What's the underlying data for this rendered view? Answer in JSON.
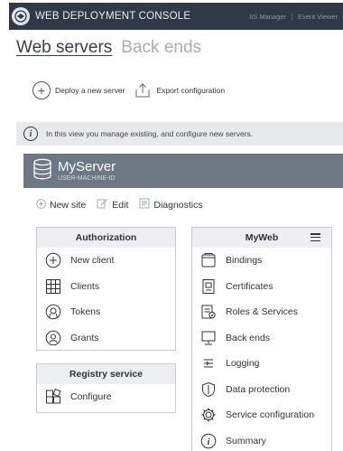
{
  "window": {
    "title": "WEB DEPLOYMENT CONSOLE",
    "links": [
      "IIS Manager",
      "Event Viewer"
    ]
  },
  "tabs": [
    {
      "label": "Web servers",
      "active": true
    },
    {
      "label": "Back ends",
      "active": false
    }
  ],
  "toolbar": {
    "deploy_label": "Deploy a new server",
    "export_label": "Export configuration"
  },
  "info": {
    "text": "In this view you manage existing, and configure new servers."
  },
  "server": {
    "name": "MyServer",
    "machine": "USER-MACHINE-ID"
  },
  "server_actions": {
    "new_site": "New site",
    "edit": "Edit",
    "diagnostics": "Diagnostics"
  },
  "authorization": {
    "title": "Authorization",
    "items": [
      {
        "label": "New client",
        "icon": "plus-circle-icon"
      },
      {
        "label": "Clients",
        "icon": "grid-icon"
      },
      {
        "label": "Tokens",
        "icon": "token-icon"
      },
      {
        "label": "Grants",
        "icon": "grant-icon"
      }
    ]
  },
  "registry": {
    "title": "Registry service",
    "items": [
      {
        "label": "Configure",
        "icon": "configure-icon"
      }
    ]
  },
  "myweb": {
    "title": "MyWeb",
    "items": [
      {
        "label": "Bindings",
        "icon": "bindings-icon"
      },
      {
        "label": "Certificates",
        "icon": "certificate-icon"
      },
      {
        "label": "Roles & Services",
        "icon": "roles-icon"
      },
      {
        "label": "Back ends",
        "icon": "backends-icon"
      },
      {
        "label": "Logging",
        "icon": "logging-icon"
      },
      {
        "label": "Data protection",
        "icon": "shield-icon"
      },
      {
        "label": "Service configuration",
        "icon": "gear-icon"
      },
      {
        "label": "Summary",
        "icon": "info-icon"
      }
    ]
  },
  "colors": {
    "titlebar": "#2f3a46",
    "server_header": "#6d7884",
    "infobar": "#e7e9ec",
    "panel_header": "#eceef1"
  }
}
